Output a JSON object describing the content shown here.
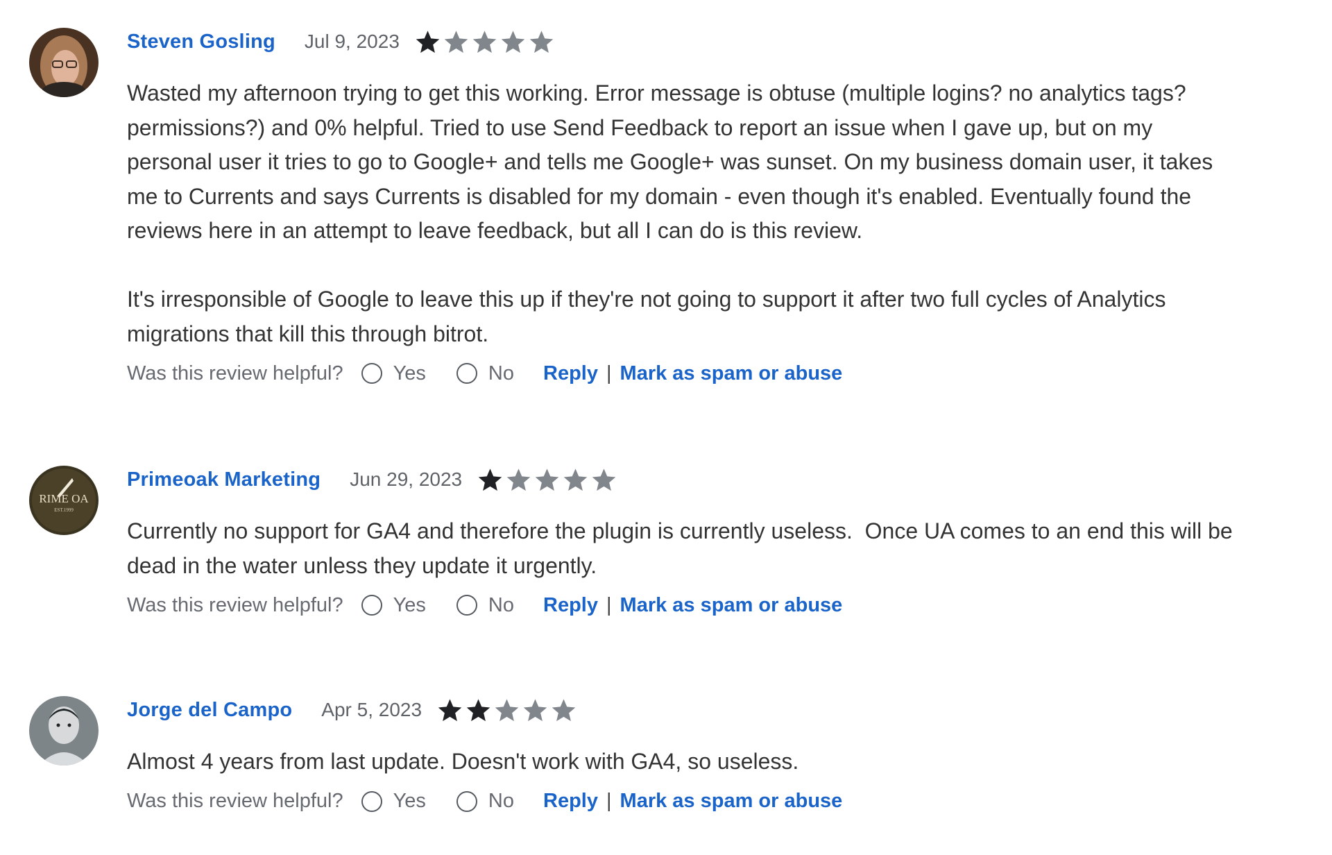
{
  "footer_labels": {
    "helpful_question": "Was this review helpful?",
    "yes": "Yes",
    "no": "No",
    "reply": "Reply",
    "separator": "|",
    "spam": "Mark as spam or abuse"
  },
  "colors": {
    "link": "#1a63c9",
    "star_filled": "#202124",
    "star_empty": "#80868b"
  },
  "reviews": [
    {
      "author": "Steven Gosling",
      "date": "Jul 9, 2023",
      "rating": 1,
      "max_rating": 5,
      "text": "Wasted my afternoon trying to get this working. Error message is obtuse (multiple logins? no analytics tags? permissions?) and 0% helpful. Tried to use Send Feedback to report an issue when I gave up, but on my personal user it tries to go to Google+ and tells me Google+ was sunset. On my business domain user, it takes me to Currents and says Currents is disabled for my domain - even though it's enabled. Eventually found the reviews here in an attempt to leave feedback, but all I can do is this review.\n\nIt's irresponsible of Google to leave this up if they're not going to support it after two full cycles of Analytics migrations that kill this through bitrot."
    },
    {
      "author": "Primeoak Marketing",
      "date": "Jun 29, 2023",
      "rating": 1,
      "max_rating": 5,
      "avatar_text": "RIME OA",
      "avatar_subtext": "EST.1999",
      "text": "Currently no support for GA4 and therefore the plugin is currently useless.  Once UA comes to an end this will be dead in the water unless they update it urgently."
    },
    {
      "author": "Jorge del Campo",
      "date": "Apr 5, 2023",
      "rating": 2,
      "max_rating": 5,
      "text": "Almost 4 years from last update. Doesn't work with GA4, so useless."
    }
  ]
}
